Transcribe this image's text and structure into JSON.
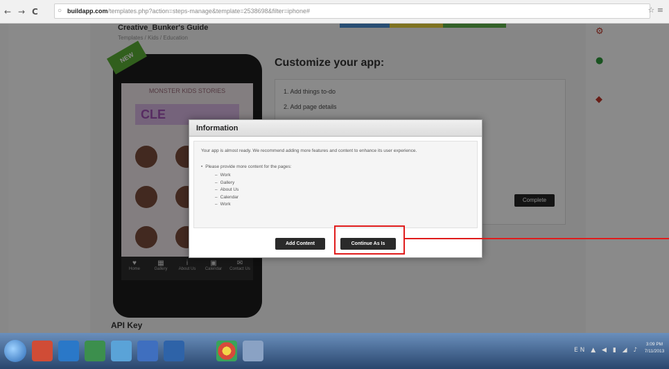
{
  "browser": {
    "back_glyph": "←",
    "forward_glyph": "→",
    "reload_glyph": "C",
    "url_domain": "buildapp.com",
    "url_path": "/templates.php?action=steps-manage&template=2538698&filter=iphone#",
    "star_glyph": "☆",
    "menu_glyph": "≡"
  },
  "page": {
    "app_name": "Creative_Bunker's Guide",
    "app_subtitle": "Templates / Kids / Education",
    "customize_title": "Customize your app:",
    "steps": [
      "1. Add things to-do",
      "2. Add page details"
    ],
    "complete_label": "Complete",
    "api_key_label": "API Key"
  },
  "phone": {
    "badge_label": "NEW",
    "screen_title": "MONSTER KIDS STORIES",
    "banner_text": "CLE",
    "tabs": [
      {
        "glyph": "♥",
        "label": "Home"
      },
      {
        "glyph": "▦",
        "label": "Gallery"
      },
      {
        "glyph": "i",
        "label": "About Us"
      },
      {
        "glyph": "▣",
        "label": "Calendar"
      },
      {
        "glyph": "✉",
        "label": "Contact Us"
      }
    ]
  },
  "dialog": {
    "title": "Information",
    "message": "Your app is almost ready. We recommend adding more features and content to enhance its user experience.",
    "note": "Please provide more content for the pages:",
    "pages": [
      "Work",
      "Gallery",
      "About Us",
      "Calendar",
      "Work"
    ],
    "add_content_label": "Add Content",
    "continue_label": "Continue As Is"
  },
  "taskbar": {
    "tray": "EN ▲ ◀ ▮ ◢ ♪",
    "time": "3:09 PM",
    "date": "7/11/2013"
  },
  "colors": {
    "highlight": "#e01c1c",
    "dialog_button": "#2a2a2a",
    "overlay": "rgba(0,0,0,0.46)"
  },
  "icons": [
    "back-icon",
    "forward-icon",
    "reload-icon",
    "page-icon",
    "star-icon",
    "menu-icon",
    "windows-start-icon",
    "chrome-icon"
  ]
}
